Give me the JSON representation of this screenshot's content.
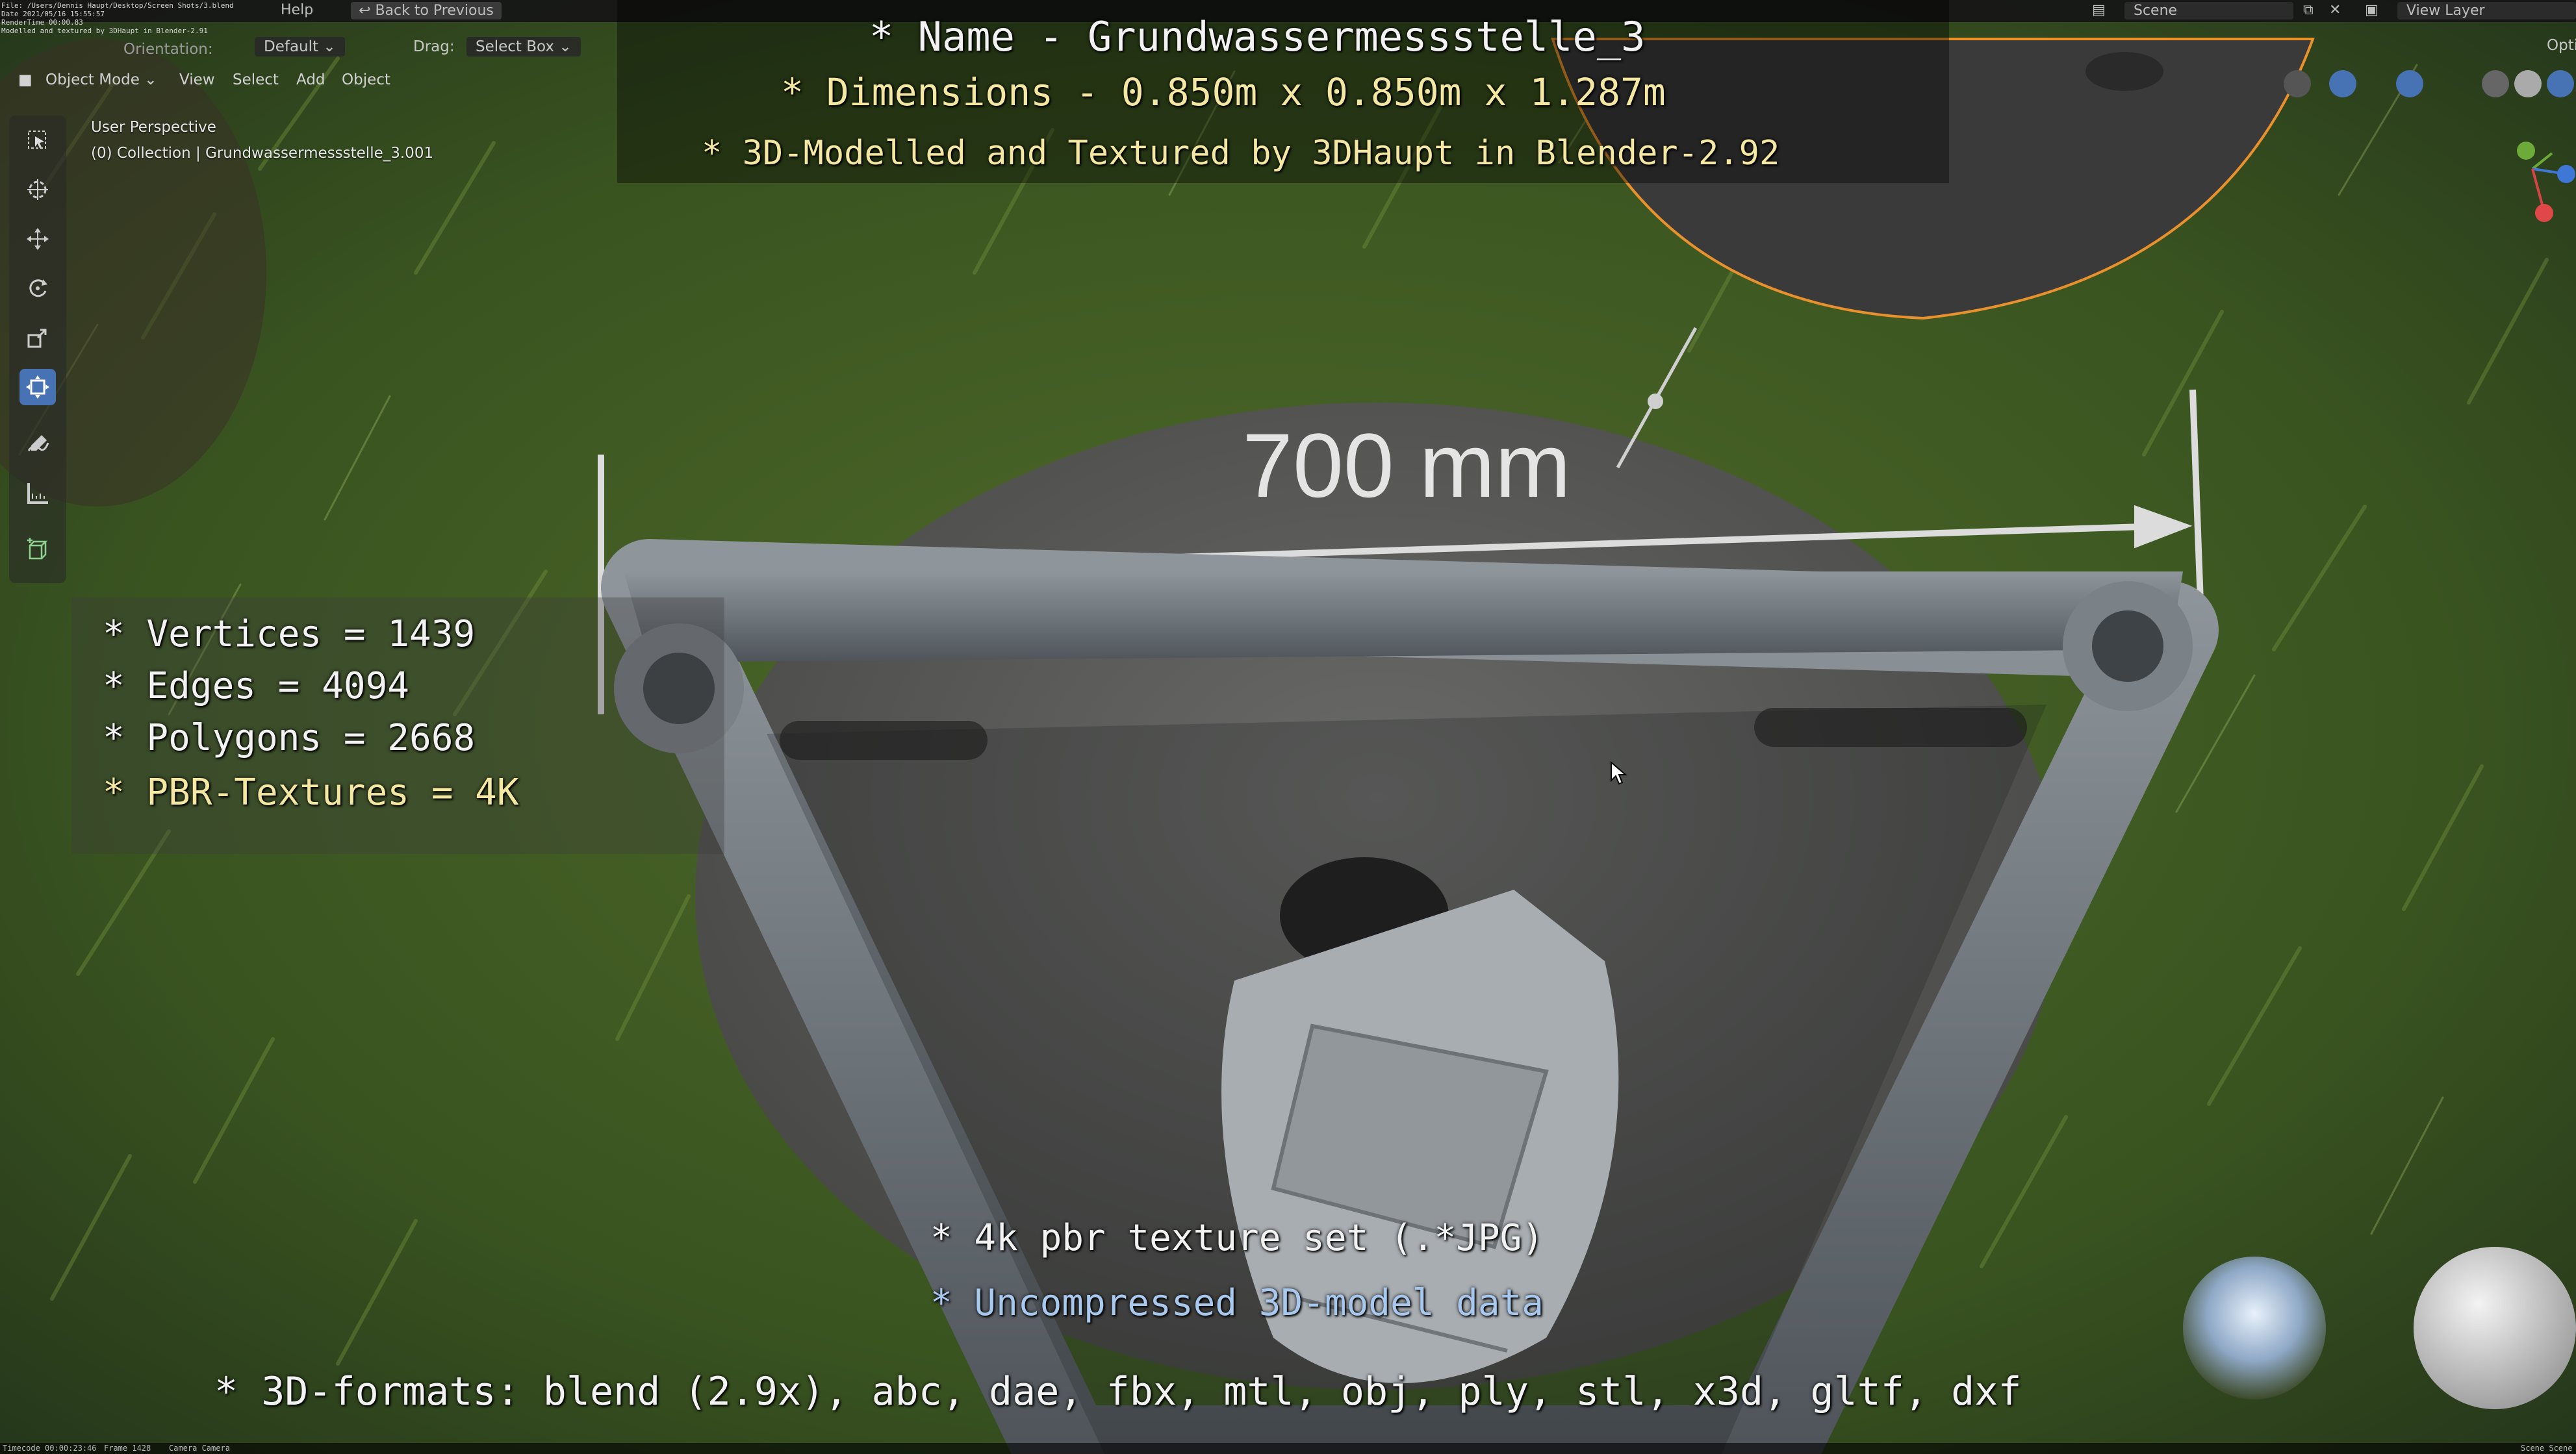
{
  "topbar": {
    "menu_help": "Help",
    "back_button": "Back to Previous",
    "scene_label": "Scene",
    "view_layer_label": "View Layer"
  },
  "header": {
    "orientation_label": "Orientation:",
    "orientation_value": "Default",
    "drag_label": "Drag:",
    "drag_value": "Select Box",
    "mode": "Object Mode",
    "menu": [
      "View",
      "Select",
      "Add",
      "Object"
    ],
    "options": "Opti"
  },
  "file_info": {
    "line1": "File: /Users/Dennis Haupt/Desktop/Screen Shots/3.blend",
    "line2": "Date 2021/05/16 15:55:57",
    "line3": "RenderTime 00:00.83",
    "line4": "Modelled and textured by 3DHaupt in Blender-2.91"
  },
  "viewport": {
    "perspective": "User Perspective",
    "collection": "(0) Collection | Grundwassermessstelle_3.001",
    "dimension_label": "700 mm"
  },
  "captions": {
    "name": "* Name - Grundwassermessstelle_3",
    "dimensions": "* Dimensions -  0.850m x 0.850m x 1.287m",
    "credit": "* 3D-Modelled and Textured by 3DHaupt in Blender-2.92",
    "vertices": "* Vertices = 1439",
    "edges": "* Edges = 4094",
    "polygons": "* Polygons = 2668",
    "textures": "* PBR-Textures = 4K",
    "texture_set": "* 4k pbr texture set (.*JPG)",
    "uncompressed": "* Uncompressed 3D-model data",
    "formats": "* 3D-formats: blend (2.9x), abc, dae, fbx, mtl, obj, ply, stl, x3d, gltf, dxf"
  },
  "statusbar": {
    "timecode": "Timecode 00:00:23:46",
    "frame": "Frame 1428",
    "camera": "Camera Camera",
    "scene_right": "Scene Scene"
  },
  "colors": {
    "caption_white": "#f2f2f2",
    "caption_yellow": "#f4e7a1",
    "caption_blue": "#a8c8ee",
    "active_tool": "#4772b3",
    "selection_outline": "#e8912d"
  },
  "icons": [
    "select-box-icon",
    "cursor-icon",
    "move-icon",
    "rotate-icon",
    "scale-icon",
    "transform-icon",
    "annotate-icon",
    "measure-icon",
    "add-cube-icon"
  ]
}
